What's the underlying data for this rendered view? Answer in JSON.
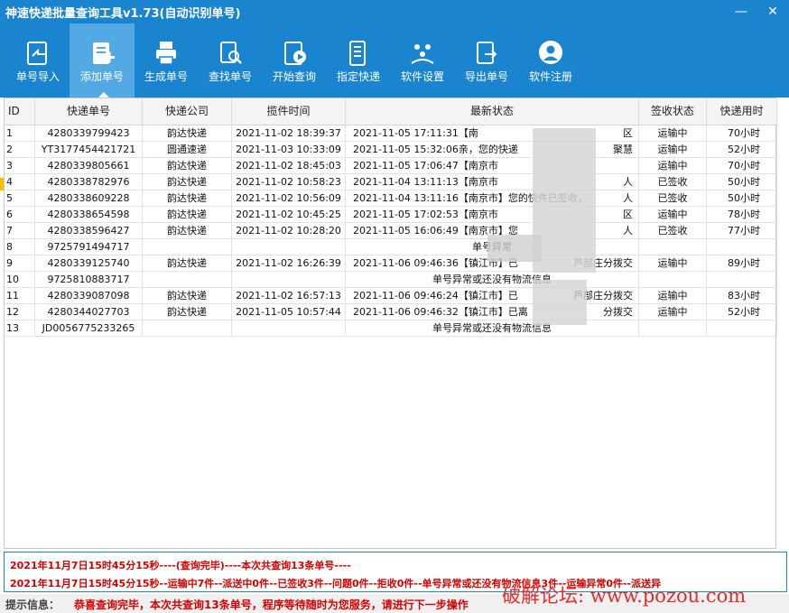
{
  "window": {
    "title": "神速快递批量查询工具v1.73(自动识别单号)",
    "minimize": "—",
    "close": "✕"
  },
  "toolbar": {
    "items": [
      {
        "label": "单号导入",
        "icon": "import-icon"
      },
      {
        "label": "添加单号",
        "icon": "add-number-icon",
        "active": true
      },
      {
        "label": "生成单号",
        "icon": "printer-icon"
      },
      {
        "label": "查找单号",
        "icon": "search-doc-icon"
      },
      {
        "label": "开始查询",
        "icon": "play-doc-icon"
      },
      {
        "label": "指定快递",
        "icon": "list-icon"
      },
      {
        "label": "软件设置",
        "icon": "settings-icon"
      },
      {
        "label": "导出单号",
        "icon": "export-icon"
      },
      {
        "label": "软件注册",
        "icon": "user-icon"
      }
    ]
  },
  "table": {
    "headers": [
      "ID",
      "快递单号",
      "快递公司",
      "揽件时间",
      "最新状态",
      "签收状态",
      "快递用时"
    ],
    "rows": [
      {
        "id": "1",
        "num": "4280339799423",
        "company": "韵达快递",
        "time": "2021-11-02 18:39:37",
        "status": "2021-11-05  17:11:31【南",
        "status_tail": "区",
        "sign": "运输中",
        "used": "70小时"
      },
      {
        "id": "2",
        "num": "YT3177454421721",
        "company": "圆通速递",
        "time": "2021-11-03 10:33:09",
        "status": "2021-11-05  15:32:06亲，您的快递",
        "status_tail": "聚慧",
        "sign": "运输中",
        "used": "52小时"
      },
      {
        "id": "3",
        "num": "4280339805661",
        "company": "韵达快递",
        "time": "2021-11-02 18:45:03",
        "status": "2021-11-05  17:06:47【南京市",
        "status_tail": "",
        "sign": "运输中",
        "used": "70小时"
      },
      {
        "id": "4",
        "num": "4280338782976",
        "company": "韵达快递",
        "time": "2021-11-02 10:58:23",
        "status": "2021-11-04  13:11:13【南京市",
        "status_tail": "人",
        "sign": "已签收",
        "used": "50小时"
      },
      {
        "id": "5",
        "num": "4280338609228",
        "company": "韵达快递",
        "time": "2021-11-02 10:56:09",
        "status": "2021-11-04  13:11:16【南京市】您的快件已签收，",
        "status_tail": "人",
        "sign": "已签收",
        "used": "50小时"
      },
      {
        "id": "6",
        "num": "4280338654598",
        "company": "韵达快递",
        "time": "2021-11-02 10:45:25",
        "status": "2021-11-05  17:02:53【南京市",
        "status_tail": "区",
        "sign": "运输中",
        "used": "78小时"
      },
      {
        "id": "7",
        "num": "4280338596427",
        "company": "韵达快递",
        "time": "2021-11-02 10:28:20",
        "status": "2021-11-05  16:06:49【南京市】您",
        "status_tail": "人",
        "sign": "已签收",
        "used": "77小时"
      },
      {
        "id": "8",
        "num": "9725791494717",
        "company": "",
        "time": "",
        "status": "单号异常",
        "status_tail": "",
        "sign": "",
        "used": "",
        "center": true
      },
      {
        "id": "9",
        "num": "4280339125740",
        "company": "韵达快递",
        "time": "2021-11-02 16:26:39",
        "status": "2021-11-06  09:46:36【镇江市】已",
        "status_tail": "芦部庄分拨交",
        "sign": "运输中",
        "used": "89小时"
      },
      {
        "id": "10",
        "num": "9725810883717",
        "company": "",
        "time": "",
        "status": "单号异常或还没有物流信息",
        "status_tail": "",
        "sign": "",
        "used": "",
        "center": true
      },
      {
        "id": "11",
        "num": "4280339087098",
        "company": "韵达快递",
        "time": "2021-11-02 16:57:13",
        "status": "2021-11-06  09:46:24【镇江市】已",
        "status_tail": "芦部庄分拨交",
        "sign": "运输中",
        "used": "83小时"
      },
      {
        "id": "12",
        "num": "4280344027703",
        "company": "韵达快递",
        "time": "2021-11-05 10:57:44",
        "status": "2021-11-06  09:46:32【镇江市】已离",
        "status_tail": "分拨交",
        "sign": "运输中",
        "used": "52小时"
      },
      {
        "id": "13",
        "num": "JD0056775233265",
        "company": "",
        "time": "",
        "status": "单号异常或还没有物流信息",
        "status_tail": "",
        "sign": "",
        "used": "",
        "center": true
      }
    ]
  },
  "log": {
    "line1": "2021年11月7日15时45分15秒----(查询完毕)----本次共查询13条单号----",
    "line2": "2021年11月7日15时45分15秒--运输中7件--派送中0件--已签收3件--问题0件--拒收0件--单号异常或还没有物流信息3件--运输异常0件--派送异"
  },
  "status": {
    "label": "提示信息：",
    "message": "恭喜查询完毕，本次共查询13条单号，程序等待随时为您服务，请进行下一步操作"
  },
  "watermark": "破解论坛:  www.pozou.com",
  "colors": {
    "titlebar": "#1a84cf",
    "active_tool": "#53a9e4",
    "log_text": "#d40000"
  }
}
